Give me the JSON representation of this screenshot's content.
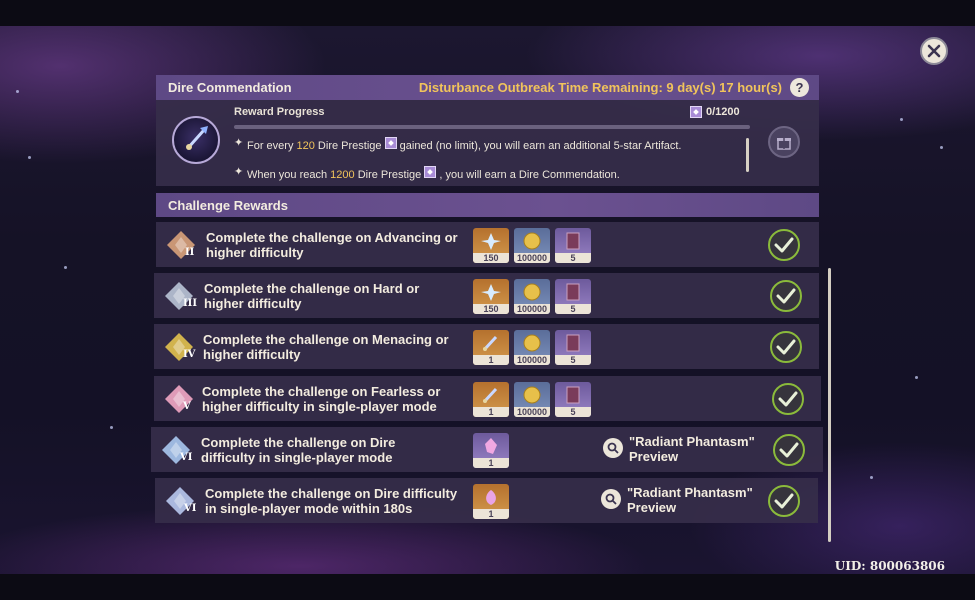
{
  "header": {
    "title": "Dire Commendation",
    "timer": "Disturbance Outbreak Time Remaining: 9 day(s) 17 hour(s)",
    "help": "?"
  },
  "commendation": {
    "progress_label": "Reward Progress",
    "progress_count": "0/1200",
    "progress_fraction": 0,
    "bullet1_pre": "For every ",
    "bullet1_num": "120",
    "bullet1_post": " Dire Prestige ",
    "bullet1_end": " gained (no limit), you will earn an additional 5-star Artifact.",
    "bullet2_pre": "When you reach ",
    "bullet2_num": "1200",
    "bullet2_post": " Dire Prestige ",
    "bullet2_end": " , you will earn a Dire Commendation."
  },
  "section": {
    "title": "Challenge Rewards"
  },
  "rows": [
    {
      "badge": "II",
      "line1": "Complete the challenge on Advancing or",
      "line2": "higher difficulty",
      "rewards": [
        "150",
        "100000",
        "5"
      ]
    },
    {
      "badge": "III",
      "line1": "Complete the challenge on Hard or",
      "line2": "higher difficulty",
      "rewards": [
        "150",
        "100000",
        "5"
      ]
    },
    {
      "badge": "IV",
      "line1": "Complete the challenge on Menacing or",
      "line2": "higher difficulty",
      "rewards": [
        "1",
        "100000",
        "5"
      ]
    },
    {
      "badge": "V",
      "line1": "Complete the challenge on Fearless or",
      "line2": "higher difficulty in single-player mode",
      "rewards": [
        "1",
        "100000",
        "5"
      ]
    },
    {
      "badge": "VI",
      "line1": "Complete the challenge on Dire",
      "line2": "difficulty in single-player mode",
      "rewards": [
        "1"
      ],
      "preview1": "\"Radiant Phantasm\"",
      "preview2": "Preview"
    },
    {
      "badge": "VI",
      "line1": "Complete the challenge on Dire difficulty",
      "line2": "in single-player mode within 180s",
      "rewards": [
        "1"
      ],
      "preview1": "\"Radiant Phantasm\"",
      "preview2": "Preview"
    }
  ],
  "footer": {
    "uid": "UID: 800063806"
  },
  "colors": {
    "accent_gold": "#f1c45b",
    "check_green": "#8bbb3b",
    "header_purple": "#6b5190"
  }
}
